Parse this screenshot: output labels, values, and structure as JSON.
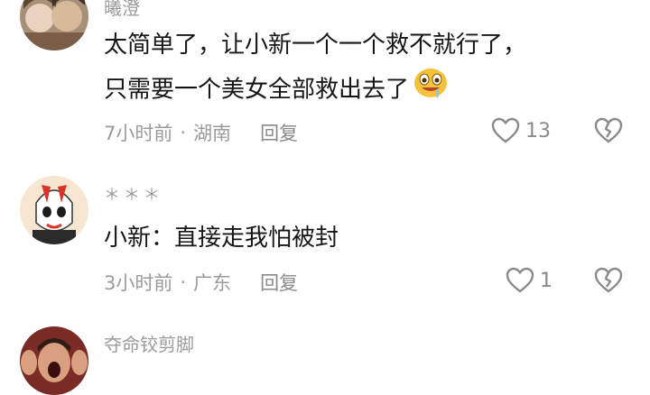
{
  "comments": [
    {
      "username": "曦澄",
      "lines": [
        "太简单了，让小新一个一个救不就行了，",
        "只需要一个美女全部救出去了"
      ],
      "emoji": "drooling-face-emoji",
      "time": "7小时前",
      "location": "湖南",
      "reply_label": "回复",
      "likes": "13",
      "avatar": "anime-couple-avatar"
    },
    {
      "username": "＊＊＊",
      "lines": [
        "小新：直接走我怕被封"
      ],
      "time": "3小时前",
      "location": "广东",
      "reply_label": "回复",
      "likes": "1",
      "avatar": "cartoon-robot-avatar"
    },
    {
      "username": "夺命铰剪脚",
      "avatar": "screaming-man-avatar"
    }
  ],
  "colors": {
    "text_primary": "#161616",
    "text_secondary": "#9b9b9b",
    "icon": "#8a8a8a"
  }
}
